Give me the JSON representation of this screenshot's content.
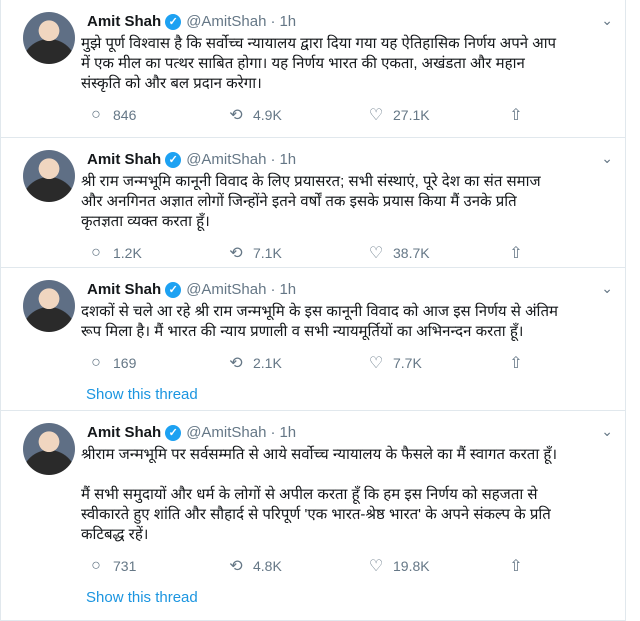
{
  "feed": [
    {
      "name": "Amit Shah",
      "handle": "@AmitShah",
      "time": "1h",
      "text": "मुझे पूर्ण विश्वास है कि सर्वोच्च न्यायालय द्वारा दिया गया यह ऐतिहासिक निर्णय अपने आप\nमें एक मील का पत्थर साबित होगा। यह निर्णय भारत की एकता, अखंडता और महान\nसंस्कृति को और बल प्रदान करेगा।",
      "replies": "846",
      "retweets": "4.9K",
      "likes": "27.1K",
      "thread": ""
    },
    {
      "name": "Amit Shah",
      "handle": "@AmitShah",
      "time": "1h",
      "text": "श्री राम जन्मभूमि कानूनी विवाद के लिए प्रयासरत; सभी संस्थाएं, पूरे देश का संत समाज\nऔर अनगिनत अज्ञात लोगों जिन्होंने इतने वर्षों तक इसके प्रयास किया मैं उनके प्रति\nकृतज्ञता व्यक्त करता हूँ।",
      "replies": "1.2K",
      "retweets": "7.1K",
      "likes": "38.7K",
      "thread": ""
    },
    {
      "name": "Amit Shah",
      "handle": "@AmitShah",
      "time": "1h",
      "text": "दशकों से चले आ रहे श्री राम जन्मभूमि के इस कानूनी विवाद को आज इस निर्णय से अंतिम\nरूप मिला है। मैं भारत की न्याय प्रणाली व सभी न्यायमूर्तियों का अभिनन्दन करता हूँ।",
      "replies": "169",
      "retweets": "2.1K",
      "likes": "7.7K",
      "thread": "Show this thread"
    },
    {
      "name": "Amit Shah",
      "handle": "@AmitShah",
      "time": "1h",
      "text": "श्रीराम जन्मभूमि पर सर्वसम्मति से आये सर्वोच्च न्यायालय के फैसले का मैं स्वागत करता हूँ।\n\nमैं सभी समुदायों और धर्म के लोगों से अपील करता हूँ कि हम इस निर्णय को सहजता से\nस्वीकारते हुए शांति और सौहार्द से परिपूर्ण 'एक भारत-श्रेष्ठ भारत' के अपने संकल्प के प्रति\nकटिबद्ध रहें।",
      "replies": "731",
      "retweets": "4.8K",
      "likes": "19.8K",
      "thread": "Show this thread"
    }
  ],
  "colors": {
    "accent": "#1da1f2",
    "link": "#1b95e0",
    "muted": "#657786",
    "border": "#e1e8ed"
  },
  "icons": {
    "reply": "reply-icon",
    "retweet": "retweet-icon",
    "like": "heart-icon",
    "share": "share-icon",
    "caret": "chevron-down-icon",
    "verified": "verified-badge-icon"
  }
}
